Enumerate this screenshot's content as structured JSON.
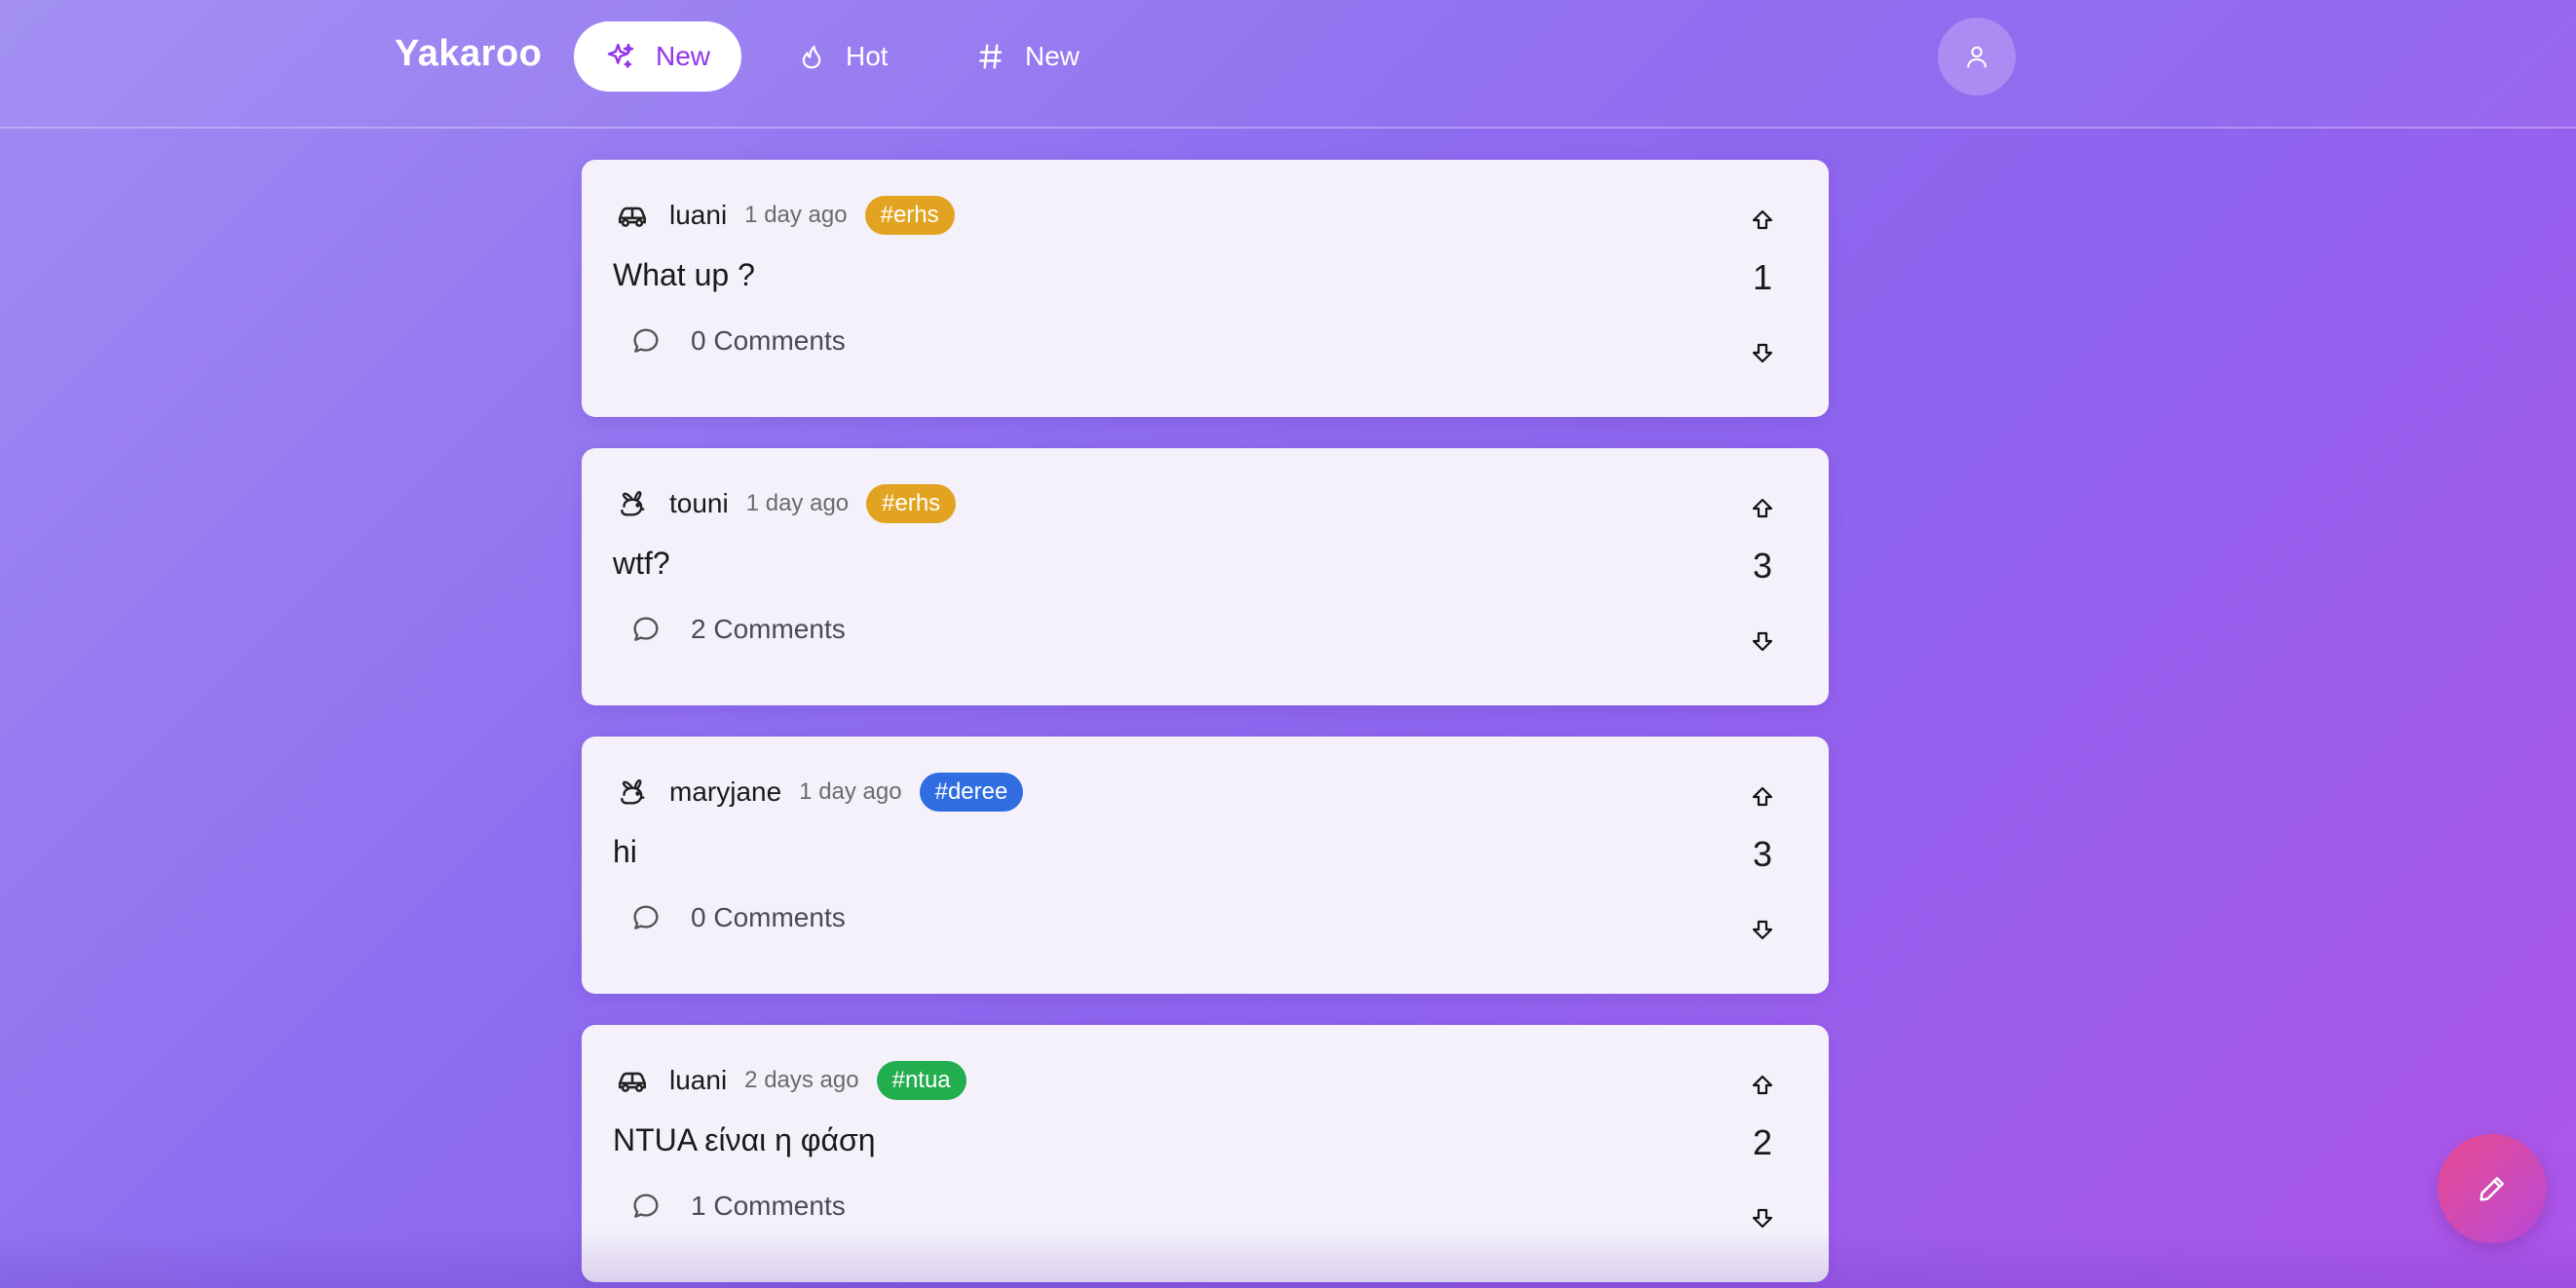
{
  "header": {
    "brand": "Yakaroo",
    "nav": [
      {
        "label": "New",
        "icon": "sparkles-icon",
        "active": true
      },
      {
        "label": "Hot",
        "icon": "flame-icon",
        "active": false
      },
      {
        "label": "New",
        "icon": "hashtag-icon",
        "active": false
      }
    ],
    "profile_icon": "user-icon"
  },
  "posts": [
    {
      "username": "luani",
      "avatar": "car-icon",
      "time": "1 day ago",
      "tag": "#erhs",
      "tag_color": "#e2a320",
      "content": "What up ?",
      "comments": "0 Comments",
      "votes": "1"
    },
    {
      "username": "touni",
      "avatar": "rabbit-icon",
      "time": "1 day ago",
      "tag": "#erhs",
      "tag_color": "#e2a320",
      "content": "wtf?",
      "comments": "2 Comments",
      "votes": "3"
    },
    {
      "username": "maryjane",
      "avatar": "rabbit-icon",
      "time": "1 day ago",
      "tag": "#deree",
      "tag_color": "#2f6de0",
      "content": "hi",
      "comments": "0 Comments",
      "votes": "3"
    },
    {
      "username": "luani",
      "avatar": "car-icon",
      "time": "2 days ago",
      "tag": "#ntua",
      "tag_color": "#22ad4e",
      "content": "NTUA είναι η φάση",
      "comments": "1 Comments",
      "votes": "2"
    }
  ],
  "fab_icon": "pencil-icon",
  "colors": {
    "accent": "#9333ea",
    "card": "#f4f1fb"
  }
}
